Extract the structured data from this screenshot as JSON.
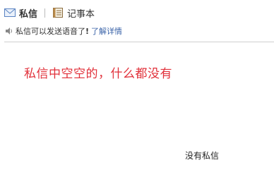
{
  "tabs": [
    {
      "label": "私信",
      "icon": "envelope-icon",
      "active": true
    },
    {
      "label": "记事本",
      "icon": "notebook-icon",
      "active": false
    }
  ],
  "notice": {
    "icon": "speaker-icon",
    "text": "私信可以发送语音了",
    "exclamation": "!",
    "link": "了解详情"
  },
  "empty_message": "私信中空空的，什么都没有",
  "footer": "没有私信",
  "colors": {
    "accent_link": "#3a63a8",
    "empty_text": "#e1303a",
    "divider": "#cfcfcf"
  }
}
